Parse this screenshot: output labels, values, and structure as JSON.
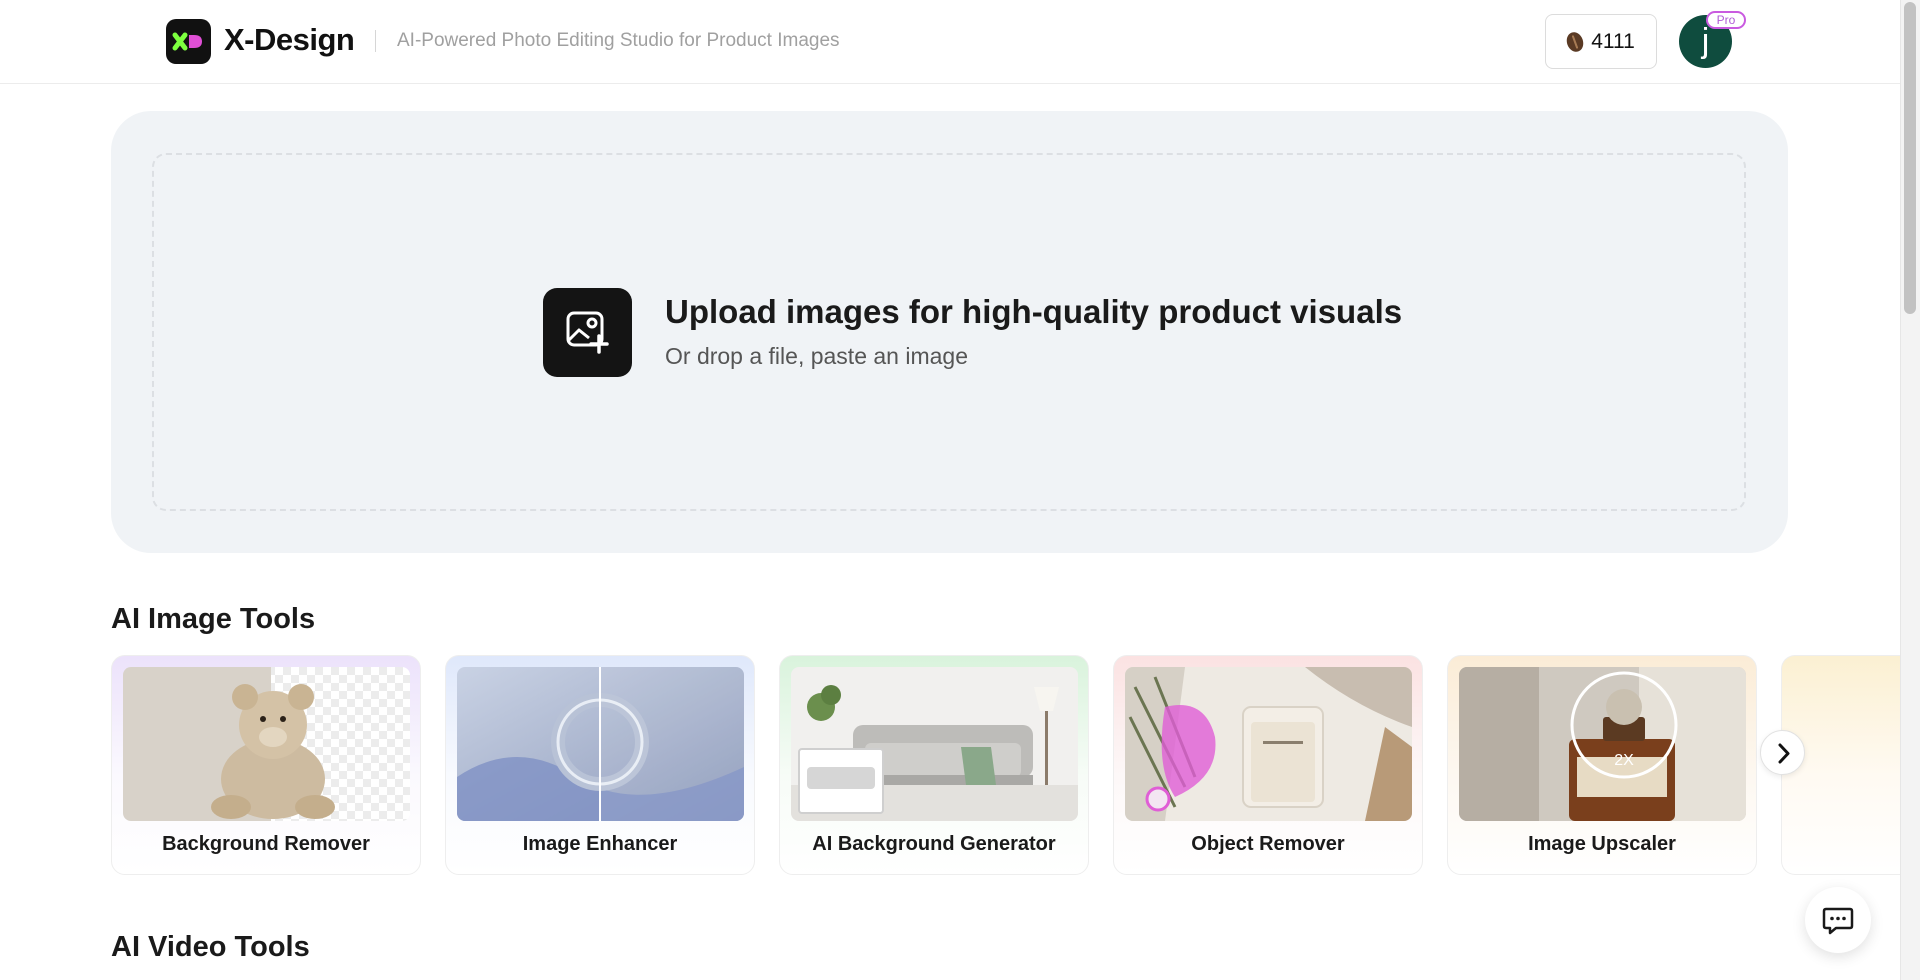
{
  "header": {
    "brand": "X-Design",
    "tagline": "AI-Powered Photo Editing Studio for Product Images",
    "credits": "4111",
    "avatar_initial": "j",
    "badge": "Pro",
    "logo_icon": "xd-logo-icon",
    "credits_icon": "coffee-bean-icon"
  },
  "upload": {
    "title": "Upload images for high-quality product visuals",
    "subtitle": "Or drop a file, paste an image",
    "icon": "image-add-icon"
  },
  "sections": {
    "image_tools_title": "AI Image Tools",
    "video_tools_title": "AI Video Tools"
  },
  "image_tools": [
    {
      "label": "Background Remover"
    },
    {
      "label": "Image Enhancer"
    },
    {
      "label": "AI Background Generator"
    },
    {
      "label": "Object Remover"
    },
    {
      "label": "Image Upscaler",
      "thumb_badge": "2X"
    }
  ],
  "controls": {
    "next_icon": "chevron-right-icon",
    "chat_icon": "chat-icon"
  },
  "colors": {
    "brand_dark": "#111111",
    "logo_green": "#7dff3f",
    "logo_pink": "#e04fd6",
    "avatar_bg": "#0f4c3e",
    "pro_badge": "#c95ae0",
    "upload_bg": "#f0f3f6"
  }
}
